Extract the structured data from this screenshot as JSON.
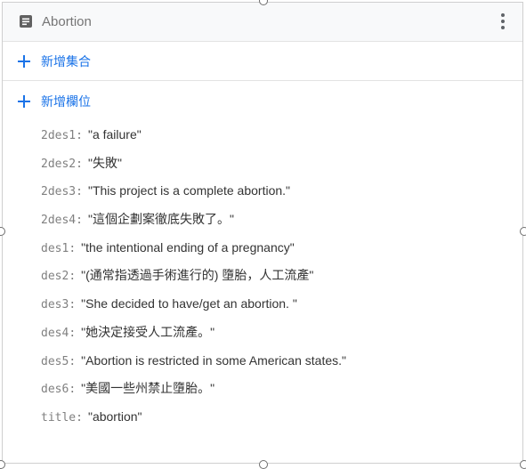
{
  "document": {
    "title": "Abortion",
    "icon": "document-icon"
  },
  "actions": {
    "add_collection_label": "新增集合",
    "add_field_label": "新增欄位",
    "more_icon": "more-vert-icon",
    "add_icon": "plus-icon"
  },
  "fields": [
    {
      "key": "2des1",
      "value": "\"a failure\""
    },
    {
      "key": "2des2",
      "value": "\"失敗\""
    },
    {
      "key": "2des3",
      "value": "\"This project is a complete abortion.\""
    },
    {
      "key": "2des4",
      "value": "\"這個企劃案徹底失敗了。\""
    },
    {
      "key": "des1",
      "value": "\"the intentional ending of a pregnancy\""
    },
    {
      "key": "des2",
      "value": "\"(通常指透過手術進行的) 墮胎，人工流產\""
    },
    {
      "key": "des3",
      "value": "\"She decided to have/get an abortion. \""
    },
    {
      "key": "des4",
      "value": "\"她決定接受人工流產。\""
    },
    {
      "key": "des5",
      "value": "\"Abortion is restricted in some American states.\""
    },
    {
      "key": "des6",
      "value": "\"美國一些州禁止墮胎。\""
    },
    {
      "key": "title",
      "value": "\"abortion\""
    }
  ],
  "colors": {
    "accent": "#1a73e8",
    "key_text": "#808080",
    "value_text": "#333333"
  }
}
